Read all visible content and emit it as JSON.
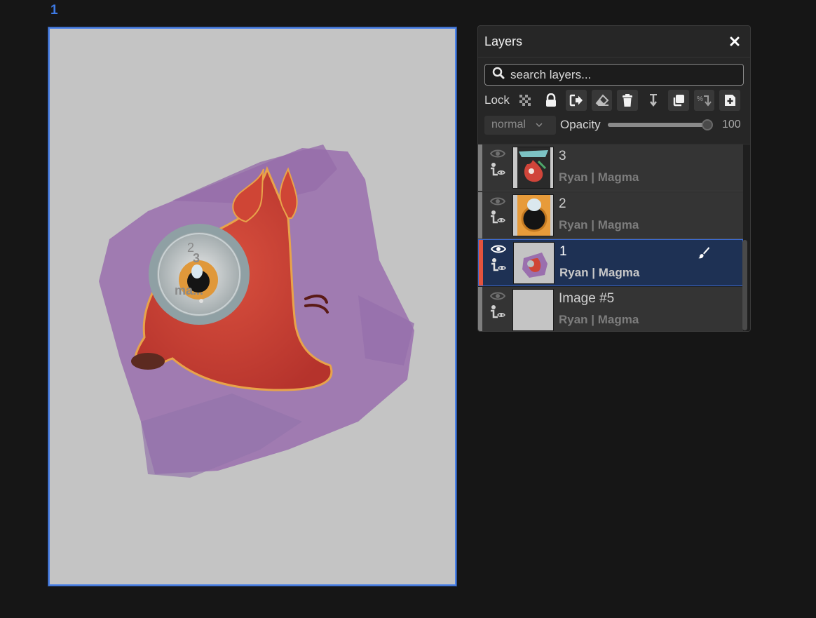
{
  "canvas": {
    "label": "1",
    "overlay_labels": [
      "2",
      "3",
      "ma..."
    ]
  },
  "panel": {
    "title": "Layers",
    "close_icon": "close-icon",
    "search": {
      "placeholder": "search layers...",
      "value": ""
    },
    "lock_label": "Lock",
    "toolbar_icons": [
      "transparency-lock-icon",
      "padlock-icon",
      "move-out-icon",
      "eraser-icon",
      "trash-icon",
      "merge-down-icon",
      "duplicate-icon",
      "clipping-mask-icon",
      "add-layer-icon"
    ],
    "blend_mode": "normal",
    "opacity_label": "Opacity",
    "opacity_value": "100",
    "opacity_fraction": 1.0,
    "layers": [
      {
        "name": "3",
        "owner": "Ryan | Magma",
        "selected": false,
        "visible": true
      },
      {
        "name": "2",
        "owner": "Ryan | Magma",
        "selected": false,
        "visible": true
      },
      {
        "name": "1",
        "owner": "Ryan | Magma",
        "selected": true,
        "visible": true
      },
      {
        "name": "Image #5",
        "owner": "Ryan | Magma",
        "selected": false,
        "visible": true
      }
    ]
  },
  "colors": {
    "accent": "#4b82e8",
    "selected_row": "#1e3154",
    "active_edge": "#e4533d",
    "canvas_bg": "#c4c4c4"
  }
}
